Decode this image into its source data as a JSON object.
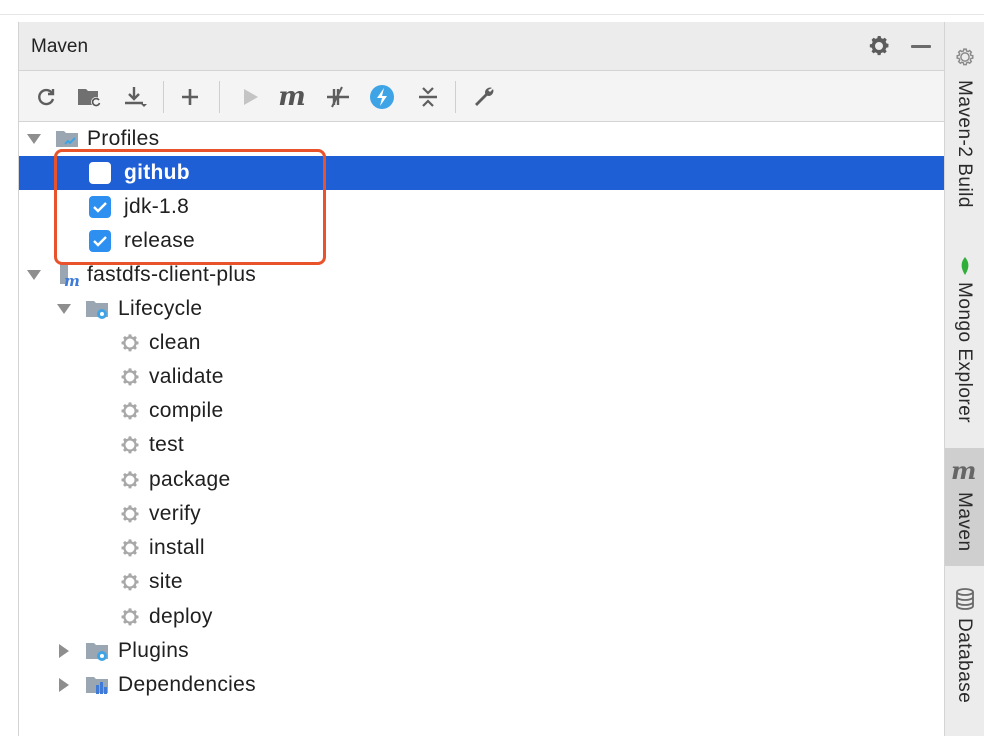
{
  "panel": {
    "title": "Maven"
  },
  "toolbar": {
    "buttons": [
      {
        "name": "reload-icon",
        "label": ""
      },
      {
        "name": "generate-sources-icon",
        "label": ""
      },
      {
        "name": "download-icon",
        "label": ""
      },
      {
        "name": "add-icon",
        "label": ""
      },
      {
        "name": "run-icon",
        "label": ""
      },
      {
        "name": "execute-goal-icon",
        "label": "m"
      },
      {
        "name": "toggle-offline-icon",
        "label": ""
      },
      {
        "name": "skip-tests-icon",
        "label": ""
      },
      {
        "name": "collapse-all-icon",
        "label": ""
      },
      {
        "name": "settings-wrench-icon",
        "label": ""
      }
    ]
  },
  "tree": {
    "profiles": {
      "label": "Profiles",
      "items": [
        {
          "label": "github",
          "checked": false,
          "selected": true
        },
        {
          "label": "jdk-1.8",
          "checked": true,
          "selected": false
        },
        {
          "label": "release",
          "checked": true,
          "selected": false
        }
      ]
    },
    "project": {
      "label": "fastdfs-client-plus",
      "lifecycle": {
        "label": "Lifecycle",
        "goals": [
          "clean",
          "validate",
          "compile",
          "test",
          "package",
          "verify",
          "install",
          "site",
          "deploy"
        ]
      },
      "plugins": {
        "label": "Plugins"
      },
      "dependencies": {
        "label": "Dependencies"
      }
    }
  },
  "sidebar": {
    "tabs": [
      {
        "label": "Maven-2 Build",
        "icon": "gear-icon",
        "active": false
      },
      {
        "label": "Mongo Explorer",
        "icon": "leaf-icon",
        "active": false
      },
      {
        "label": "Maven",
        "icon": "maven-m-icon",
        "active": true
      },
      {
        "label": "Database",
        "icon": "database-icon",
        "active": false
      }
    ]
  },
  "colors": {
    "selection": "#1f5fd6",
    "checkbox": "#2d8ff0",
    "highlight": "#e8532c"
  }
}
